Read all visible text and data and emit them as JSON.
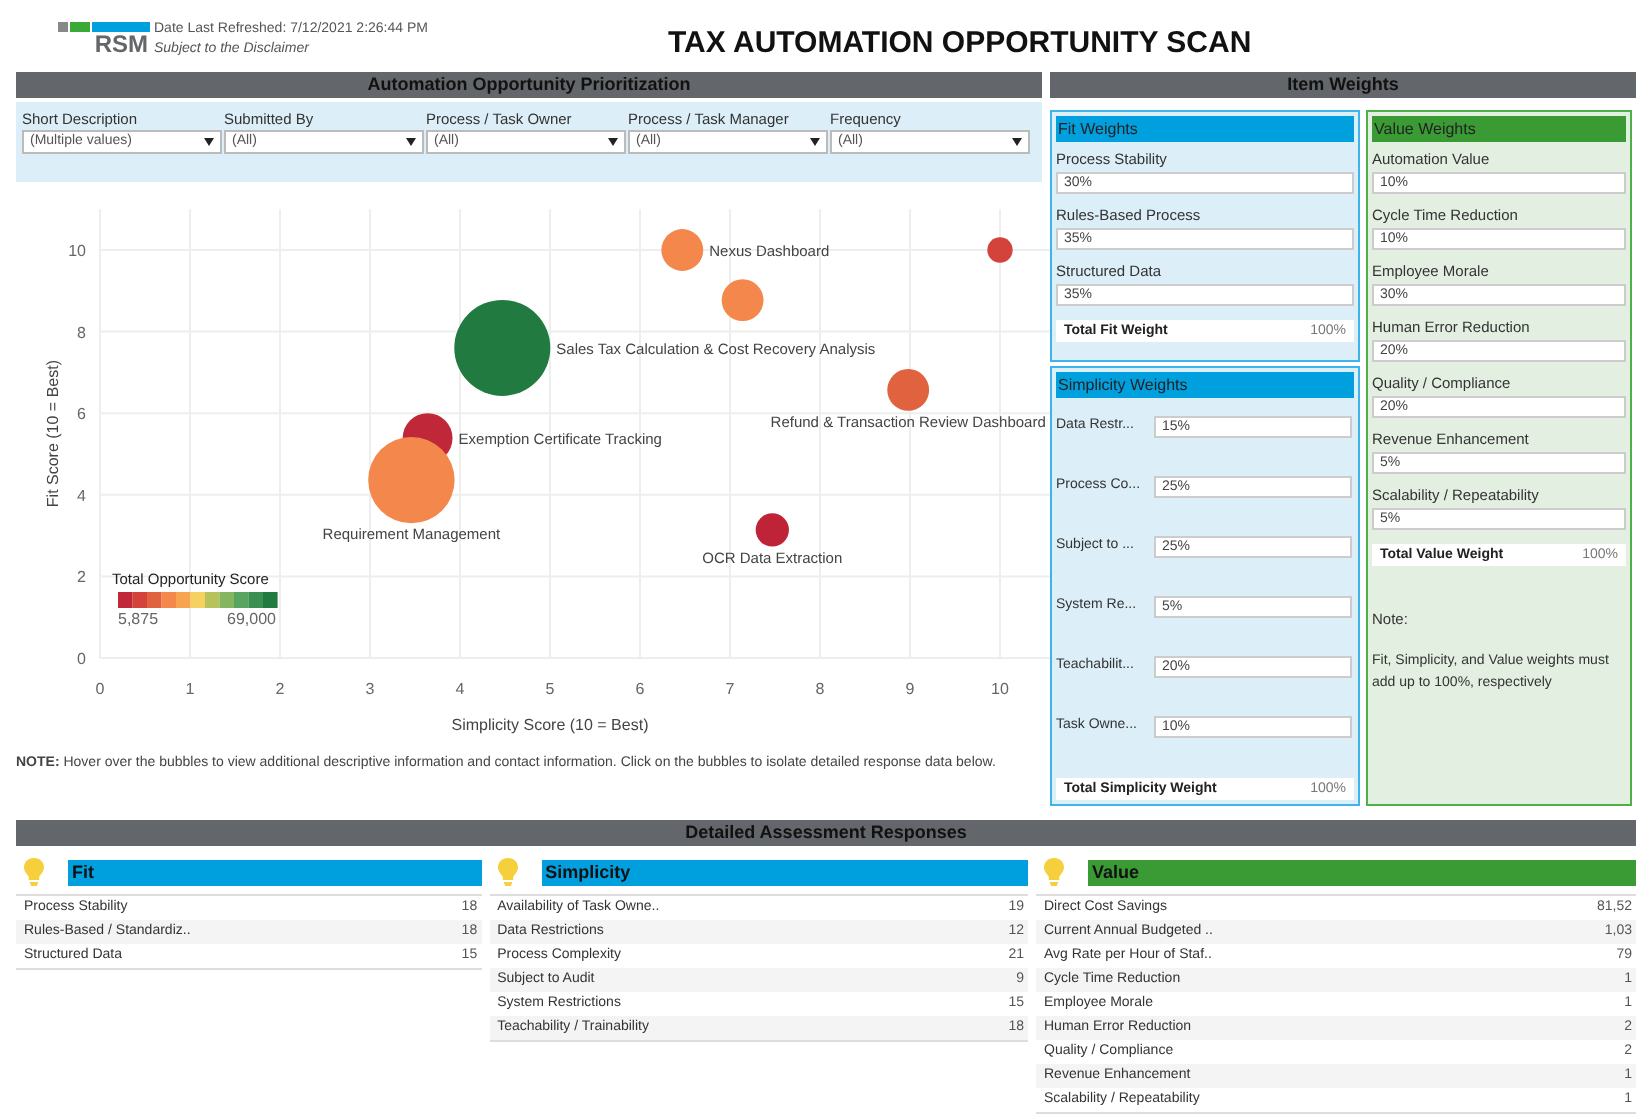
{
  "header": {
    "logo_text": "RSM",
    "refreshed": "Date Last Refreshed: 7/12/2021 2:26:44 PM",
    "disclaimer": "Subject to the Disclaimer",
    "title": "TAX AUTOMATION OPPORTUNITY SCAN"
  },
  "prioritization": {
    "title": "Automation Opportunity Prioritization",
    "filters": [
      {
        "label": "Short Description",
        "value": "(Multiple values)"
      },
      {
        "label": "Submitted By",
        "value": "(All)"
      },
      {
        "label": "Process / Task Owner",
        "value": "(All)"
      },
      {
        "label": "Process / Task Manager",
        "value": "(All)"
      },
      {
        "label": "Frequency",
        "value": "(All)"
      }
    ],
    "chart_data": {
      "type": "scatter",
      "xlabel": "Simplicity Score (10 = Best)",
      "ylabel": "Fit Score (10 = Best)",
      "xlim": [
        0,
        10.6
      ],
      "ylim": [
        0,
        11
      ],
      "xticks": [
        0,
        1,
        2,
        3,
        4,
        5,
        6,
        7,
        8,
        9,
        10
      ],
      "yticks": [
        0,
        2,
        4,
        6,
        8,
        10
      ],
      "grid": true,
      "x": [
        6.47,
        10,
        7.14,
        4.47,
        8.98,
        3.64,
        3.46,
        7.47
      ],
      "series": [
        {
          "name": "Nexus Dashboard",
          "color": "#f4874b",
          "values": [
            10,
            null,
            null,
            null,
            null,
            null,
            null,
            null
          ],
          "sizes": [
            0.19,
            null,
            null,
            null,
            null,
            null,
            null,
            null
          ]
        },
        {
          "color": "#d4423c",
          "values": [
            null,
            10,
            null,
            null,
            null,
            null,
            null,
            null
          ],
          "sizes": [
            null,
            0.07,
            null,
            null,
            null,
            null,
            null,
            null
          ]
        },
        {
          "color": "#f4874b",
          "values": [
            null,
            null,
            8.77,
            null,
            null,
            null,
            null,
            null
          ],
          "sizes": [
            null,
            null,
            0.19,
            null,
            null,
            null,
            null,
            null
          ]
        },
        {
          "name": "Sales Tax Calculation & Cost Recovery Analysis",
          "color": "#217a40",
          "values": [
            null,
            null,
            null,
            7.6,
            null,
            null,
            null,
            null
          ],
          "sizes": [
            null,
            null,
            null,
            1,
            null,
            null,
            null,
            null
          ]
        },
        {
          "name": "Refund & Transaction Review Dashboard",
          "color": "#e0623f",
          "values": [
            null,
            null,
            null,
            null,
            6.57,
            null,
            null,
            null
          ],
          "sizes": [
            null,
            null,
            null,
            null,
            0.19,
            null,
            null,
            null
          ]
        },
        {
          "name": "Exemption Certificate Tracking",
          "color": "#c0283a",
          "values": [
            null,
            null,
            null,
            null,
            null,
            5.39,
            null,
            null
          ],
          "sizes": [
            null,
            null,
            null,
            null,
            null,
            0.27,
            null,
            null
          ]
        },
        {
          "name": "Requirement Management",
          "color": "#f4874b",
          "values": [
            null,
            null,
            null,
            null,
            null,
            null,
            4.36,
            null
          ],
          "sizes": [
            null,
            null,
            null,
            null,
            null,
            null,
            0.81,
            null
          ]
        },
        {
          "name": "OCR Data Extraction",
          "color": "#bf2338",
          "values": [
            null,
            null,
            null,
            null,
            null,
            null,
            null,
            3.14
          ],
          "sizes": [
            null,
            null,
            null,
            null,
            null,
            null,
            null,
            0.12
          ]
        }
      ]
    },
    "legend": {
      "title": "Total Opportunity Score",
      "min": "5,875",
      "max": "69,000"
    },
    "note": "**NOTE:** Hover over the bubbles to view additional descriptive information and contact information.  Click on the bubbles to isolate detailed response data below."
  },
  "item_weights": {
    "title": "Item Weights",
    "fit": {
      "title": "Fit Weights",
      "items": [
        {
          "label": "Process Stability",
          "value": "30%"
        },
        {
          "label": "Rules-Based Process",
          "value": "35%"
        },
        {
          "label": "Structured Data",
          "value": "35%"
        }
      ],
      "total_label": "Total Fit Weight",
      "total_value": "100%"
    },
    "simplicity": {
      "title": "Simplicity Weights",
      "items": [
        {
          "label": "Data Restr...",
          "value": "15%"
        },
        {
          "label": "Process Co...",
          "value": "25%"
        },
        {
          "label": "Subject to ...",
          "value": "25%"
        },
        {
          "label": "System Re...",
          "value": "5%"
        },
        {
          "label": "Teachabilit...",
          "value": "20%"
        },
        {
          "label": "Task Owne...",
          "value": "10%"
        }
      ],
      "total_label": "Total Simplicity Weight",
      "total_value": "100%"
    },
    "value": {
      "title": "Value Weights",
      "items": [
        {
          "label": "Automation Value",
          "value": "10%"
        },
        {
          "label": "Cycle Time Reduction",
          "value": "10%"
        },
        {
          "label": "Employee Morale",
          "value": "30%"
        },
        {
          "label": "Human Error Reduction",
          "value": "20%"
        },
        {
          "label": "Quality / Compliance",
          "value": "20%"
        },
        {
          "label": "Revenue Enhancement",
          "value": "5%"
        },
        {
          "label": "Scalability / Repeatability",
          "value": "5%"
        }
      ],
      "total_label": "Total Value Weight",
      "total_value": "100%",
      "note_title": "Note:",
      "note_text": "Fit, Simplicity, and Value weights must add up to 100%, respectively"
    }
  },
  "responses": {
    "title": "Detailed Assessment Responses",
    "groups": [
      {
        "kind": "fit",
        "title": "Fit",
        "rows": [
          {
            "label": "Process Stability",
            "value": "18"
          },
          {
            "label": "Rules-Based / Standardiz..",
            "value": "18"
          },
          {
            "label": "Structured Data",
            "value": "15"
          }
        ]
      },
      {
        "kind": "simplicity",
        "title": "Simplicity",
        "rows": [
          {
            "label": "Availability of Task Owne..",
            "value": "19"
          },
          {
            "label": "Data Restrictions",
            "value": "12"
          },
          {
            "label": "Process Complexity",
            "value": "21"
          },
          {
            "label": "Subject to Audit",
            "value": "9"
          },
          {
            "label": "System Restrictions",
            "value": "15"
          },
          {
            "label": "Teachability / Trainability",
            "value": "18"
          }
        ]
      },
      {
        "kind": "value",
        "title": "Value",
        "rows": [
          {
            "label": "Direct Cost Savings",
            "value": "81,52"
          },
          {
            "label": "Current Annual Budgeted ..",
            "value": "1,03"
          },
          {
            "label": "Avg Rate per Hour of Staf..",
            "value": "79"
          },
          {
            "label": "Cycle Time Reduction",
            "value": "1"
          },
          {
            "label": "Employee Morale",
            "value": "1"
          },
          {
            "label": "Human Error Reduction",
            "value": "2"
          },
          {
            "label": "Quality / Compliance",
            "value": "2"
          },
          {
            "label": "Revenue Enhancement",
            "value": "1"
          },
          {
            "label": "Scalability / Repeatability",
            "value": "1"
          }
        ]
      }
    ]
  }
}
